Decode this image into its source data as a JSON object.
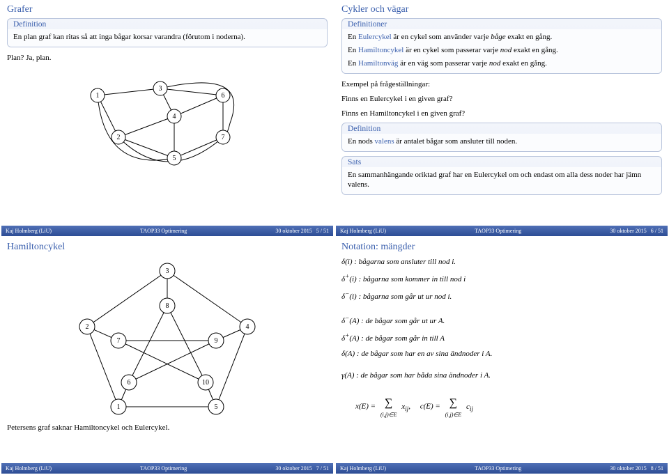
{
  "footer": {
    "author": "Kaj Holmberg (LiU)",
    "course": "TAOP33 Optimering",
    "date": "30 oktober 2015"
  },
  "slide5": {
    "title": "Grafer",
    "defHead": "Definition",
    "defBody": "En plan graf kan ritas så att inga bågar korsar varandra (förutom i noderna).",
    "plan": "Plan? Ja, plan.",
    "page": "5 / 51"
  },
  "slide6": {
    "title": "Cykler och vägar",
    "defsHead": "Definitioner",
    "euler1a": "En ",
    "euler1b": "Eulercykel",
    "euler1c": " är en cykel som använder varje ",
    "euler1d": "båge",
    "euler1e": " exakt en gång.",
    "ham1a": "En ",
    "ham1b": "Hamiltoncykel",
    "ham1c": " är en cykel som passerar varje ",
    "ham1d": "nod",
    "ham1e": " exakt en gång.",
    "hv1a": "En ",
    "hv1b": "Hamiltonväg",
    "hv1c": " är en väg som passerar varje ",
    "hv1d": "nod",
    "hv1e": " exakt en gång.",
    "ex1": "Exempel på frågeställningar:",
    "ex2": "Finns en Eulercykel i en given graf?",
    "ex3": "Finns en Hamiltoncykel i en given graf?",
    "def2Head": "Definition",
    "def2a": "En nods ",
    "def2b": "valens",
    "def2c": " är antalet bågar som ansluter till noden.",
    "satsHead": "Sats",
    "satsBody": "En sammanhängande oriktad graf har en Eulercykel om och endast om alla dess noder har jämn valens.",
    "page": "6 / 51"
  },
  "slide7": {
    "title": "Hamiltoncykel",
    "caption": "Petersens graf saknar Hamiltoncykel och Eulercykel.",
    "page": "7 / 51"
  },
  "slide8": {
    "title": "Notation: mängder",
    "l1": "δ(i) : bågarna som ansluter till nod i.",
    "l2a": "δ",
    "l2b": "(i) : bågarna som kommer in till nod i",
    "l3a": "δ",
    "l3b": "(i) : bågarna som går ut ur nod i.",
    "l4a": "δ",
    "l4b": "(A) : de bågar som går ut ur A.",
    "l5a": "δ",
    "l5b": "(A) : de bågar som går in till A",
    "l6": "δ(A) : de bågar som har en av sina ändnoder i A.",
    "l7": "γ(A) : de bågar som har båda sina ändnoder i A.",
    "eqL": "x(E) =",
    "eqSumSub": "(i,j)∈E",
    "eqXij": "xij",
    "eqComma": ",",
    "eqR": "c(E) =",
    "eqCij": "cij",
    "page": "8 / 51"
  }
}
